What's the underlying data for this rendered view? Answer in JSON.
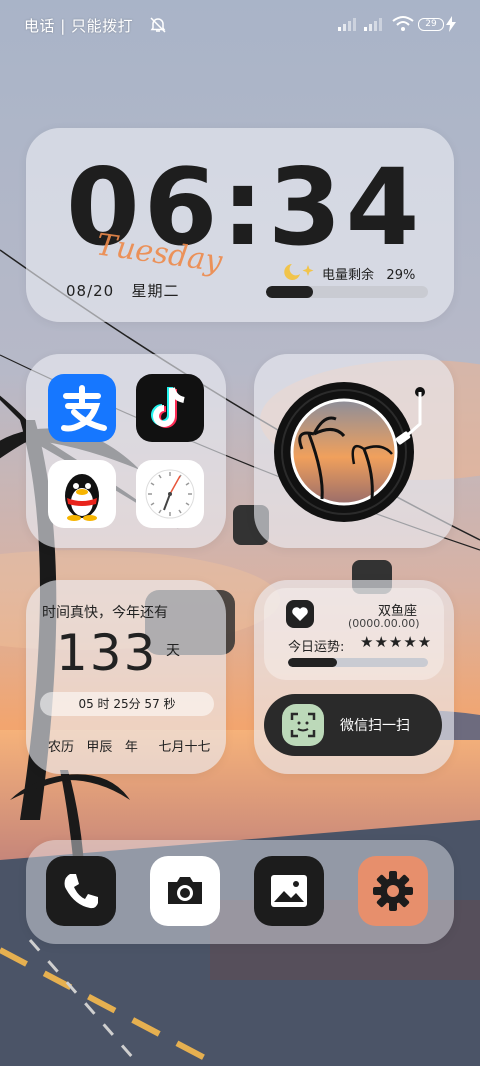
{
  "status_bar": {
    "carrier": "电话 | 只能拨打",
    "battery": "29"
  },
  "clock_widget": {
    "time": "06:34",
    "weekday_en": "Tuesday",
    "date": "08/20",
    "weekday_cn": "星期二",
    "battery_label": "电量剩余",
    "battery_percent": "29%",
    "battery_fraction": 0.29
  },
  "apps": [
    {
      "name": "alipay",
      "color": "#1677ff"
    },
    {
      "name": "douyin",
      "color": "#111111"
    },
    {
      "name": "qq",
      "color": "#ffffff"
    },
    {
      "name": "clock",
      "color": "#ffffff"
    }
  ],
  "countdown": {
    "heading": "时间真快，今年还有",
    "days": "133",
    "days_unit": "天",
    "remaining": "05 时 25分 57 秒",
    "lunar_label": "农历",
    "lunar_year": "甲辰",
    "lunar_year_unit": "年",
    "lunar_date": "七月十七"
  },
  "horoscope": {
    "sign": "双鱼座",
    "birth": "(0000.00.00)",
    "fortune_label": "今日运势:",
    "stars": "★★★★★",
    "fortune_fraction": 0.35
  },
  "wechat_scan": {
    "label": "微信扫一扫"
  },
  "dock": [
    {
      "name": "phone"
    },
    {
      "name": "camera"
    },
    {
      "name": "gallery"
    },
    {
      "name": "settings",
      "color": "#e78f6c"
    }
  ]
}
